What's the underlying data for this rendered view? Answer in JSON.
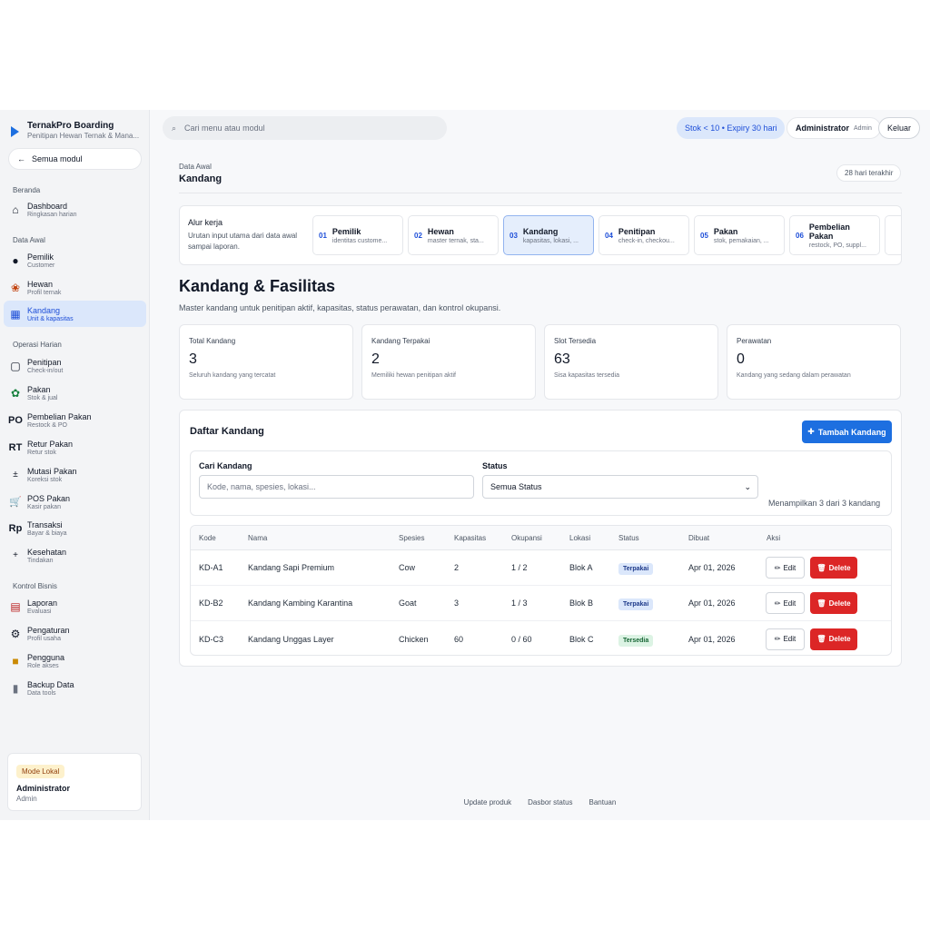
{
  "brand": {
    "title": "TernakPro Boarding",
    "subtitle": "Penitipan Hewan Ternak & Mana..."
  },
  "all_modules": "Semua modul",
  "sidebar": {
    "sections": [
      "Beranda",
      "Data Awal",
      "Operasi Harian",
      "Kontrol Bisnis"
    ],
    "items": [
      {
        "label": "Dashboard",
        "sub": "Ringkasan harian",
        "icon": "⌂"
      },
      {
        "label": "Pemilik",
        "sub": "Customer",
        "icon": "●"
      },
      {
        "label": "Hewan",
        "sub": "Profil ternak",
        "icon": "❀"
      },
      {
        "label": "Kandang",
        "sub": "Unit & kapasitas",
        "icon": "▦"
      },
      {
        "label": "Penitipan",
        "sub": "Check-in/out",
        "icon": "▢"
      },
      {
        "label": "Pakan",
        "sub": "Stok & jual",
        "icon": "✿"
      },
      {
        "label": "Pembelian Pakan",
        "sub": "Restock & PO",
        "icon": "PO"
      },
      {
        "label": "Retur Pakan",
        "sub": "Retur stok",
        "icon": "RT"
      },
      {
        "label": "Mutasi Pakan",
        "sub": "Koreksi stok",
        "icon": "±"
      },
      {
        "label": "POS Pakan",
        "sub": "Kasir pakan",
        "icon": "🛒"
      },
      {
        "label": "Transaksi",
        "sub": "Bayar & biaya",
        "icon": "Rp"
      },
      {
        "label": "Kesehatan",
        "sub": "Tindakan",
        "icon": "+"
      },
      {
        "label": "Laporan",
        "sub": "Evaluasi",
        "icon": "▤"
      },
      {
        "label": "Pengaturan",
        "sub": "Profil usaha",
        "icon": "⚙"
      },
      {
        "label": "Pengguna",
        "sub": "Role akses",
        "icon": "■"
      },
      {
        "label": "Backup Data",
        "sub": "Data tools",
        "icon": "▮"
      }
    ]
  },
  "user": {
    "mode": "Mode Lokal",
    "name": "Administrator",
    "role": "Admin"
  },
  "topbar": {
    "search_placeholder": "Cari menu atau modul",
    "stock_alert": "Stok < 10 • Expiry 30 hari",
    "user_name": "Administrator",
    "user_role": "Admin",
    "logout": "Keluar"
  },
  "breadcrumb": {
    "section": "Data Awal",
    "page": "Kandang",
    "range": "28 hari terakhir"
  },
  "workflow": {
    "title": "Alur kerja",
    "desc": "Urutan input utama dari data awal sampai laporan.",
    "steps": [
      {
        "no": "01",
        "label": "Pemilik",
        "desc": "identitas custome..."
      },
      {
        "no": "02",
        "label": "Hewan",
        "desc": "master ternak, sta..."
      },
      {
        "no": "03",
        "label": "Kandang",
        "desc": "kapasitas, lokasi, ..."
      },
      {
        "no": "04",
        "label": "Penitipan",
        "desc": "check-in, checkou..."
      },
      {
        "no": "05",
        "label": "Pakan",
        "desc": "stok, pemakaian, ..."
      },
      {
        "no": "06",
        "label": "Pembelian Pakan",
        "desc": "restock, PO, suppl..."
      }
    ]
  },
  "page": {
    "title": "Kandang & Fasilitas",
    "lead": "Master kandang untuk penitipan aktif, kapasitas, status perawatan, dan kontrol okupansi."
  },
  "stats": [
    {
      "label": "Total Kandang",
      "value": "3",
      "caption": "Seluruh kandang yang tercatat"
    },
    {
      "label": "Kandang Terpakai",
      "value": "2",
      "caption": "Memiliki hewan penitipan aktif"
    },
    {
      "label": "Slot Tersedia",
      "value": "63",
      "caption": "Sisa kapasitas tersedia"
    },
    {
      "label": "Perawatan",
      "value": "0",
      "caption": "Kandang yang sedang dalam perawatan"
    }
  ],
  "list": {
    "title": "Daftar Kandang",
    "add_button": "Tambah Kandang",
    "search_label": "Cari Kandang",
    "search_placeholder": "Kode, nama, spesies, lokasi...",
    "status_label": "Status",
    "status_value": "Semua Status",
    "showing": "Menampilkan 3 dari 3 kandang",
    "columns": [
      "Kode",
      "Nama",
      "Spesies",
      "Kapasitas",
      "Okupansi",
      "Lokasi",
      "Status",
      "Dibuat",
      "Aksi"
    ],
    "rows": [
      {
        "kode": "KD-A1",
        "nama": "Kandang Sapi Premium",
        "spesies": "Cow",
        "kapasitas": "2",
        "okupansi": "1 / 2",
        "lokasi": "Blok A",
        "status": "Terpakai",
        "dibuat": "Apr 01, 2026"
      },
      {
        "kode": "KD-B2",
        "nama": "Kandang Kambing Karantina",
        "spesies": "Goat",
        "kapasitas": "3",
        "okupansi": "1 / 3",
        "lokasi": "Blok B",
        "status": "Terpakai",
        "dibuat": "Apr 01, 2026"
      },
      {
        "kode": "KD-C3",
        "nama": "Kandang Unggas Layer",
        "spesies": "Chicken",
        "kapasitas": "60",
        "okupansi": "0 / 60",
        "lokasi": "Blok C",
        "status": "Tersedia",
        "dibuat": "Apr 01, 2026"
      }
    ],
    "edit_label": "Edit",
    "delete_label": "Delete"
  },
  "footer": [
    "Update produk",
    "Dasbor status",
    "Bantuan"
  ],
  "colors": {
    "accent": "#1d6fe0",
    "danger": "#dc2626",
    "active_bg": "#dbe7fb"
  }
}
